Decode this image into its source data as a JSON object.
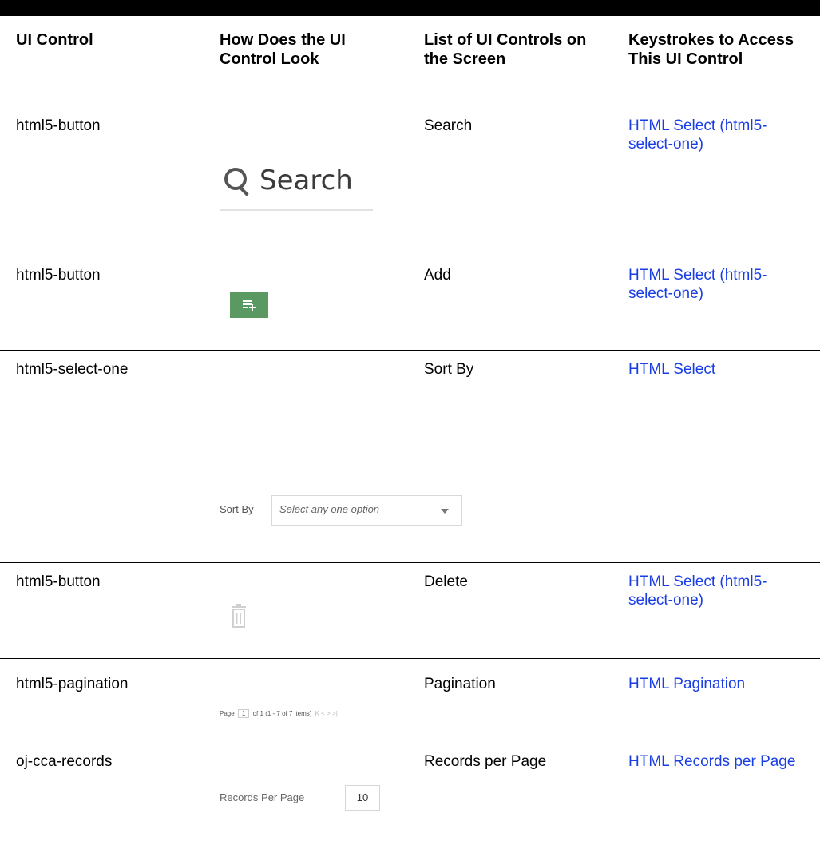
{
  "headers": [
    "UI Control",
    "How Does the UI Control Look",
    "List of UI Controls on the Screen",
    "Keystrokes to Access This UI Control"
  ],
  "rows": [
    {
      "control": "html5-button",
      "list": "Search",
      "keystroke": "HTML Select (html5-select-one)"
    },
    {
      "control": "html5-button",
      "list": "Add",
      "keystroke": "HTML Select (html5-select-one)"
    },
    {
      "control": "html5-select-one",
      "list": "Sort By",
      "keystroke": "HTML Select"
    },
    {
      "control": "html5-button",
      "list": "Delete",
      "keystroke": "HTML Select (html5-select-one)"
    },
    {
      "control": "html5-pagination",
      "list": "Pagination",
      "keystroke": "HTML Pagination"
    },
    {
      "control": "oj-cca-records",
      "list": "Records per Page",
      "keystroke": "HTML Records per Page"
    }
  ],
  "previews": {
    "search_text": "Search",
    "sort_label": "Sort By",
    "sort_placeholder": "Select any one option",
    "pagination": {
      "page_label": "Page",
      "page_value": "1",
      "of_text": "of 1",
      "items_text": "(1 - 7 of 7 items)",
      "nav": "K < > >|"
    },
    "records_label": "Records Per Page",
    "records_value": "10"
  },
  "colors": {
    "link": "#1a3ee6",
    "add_button": "#5a9a62"
  },
  "icons": [
    "search-icon",
    "add-row-icon",
    "chevron-down-icon",
    "trash-icon"
  ]
}
